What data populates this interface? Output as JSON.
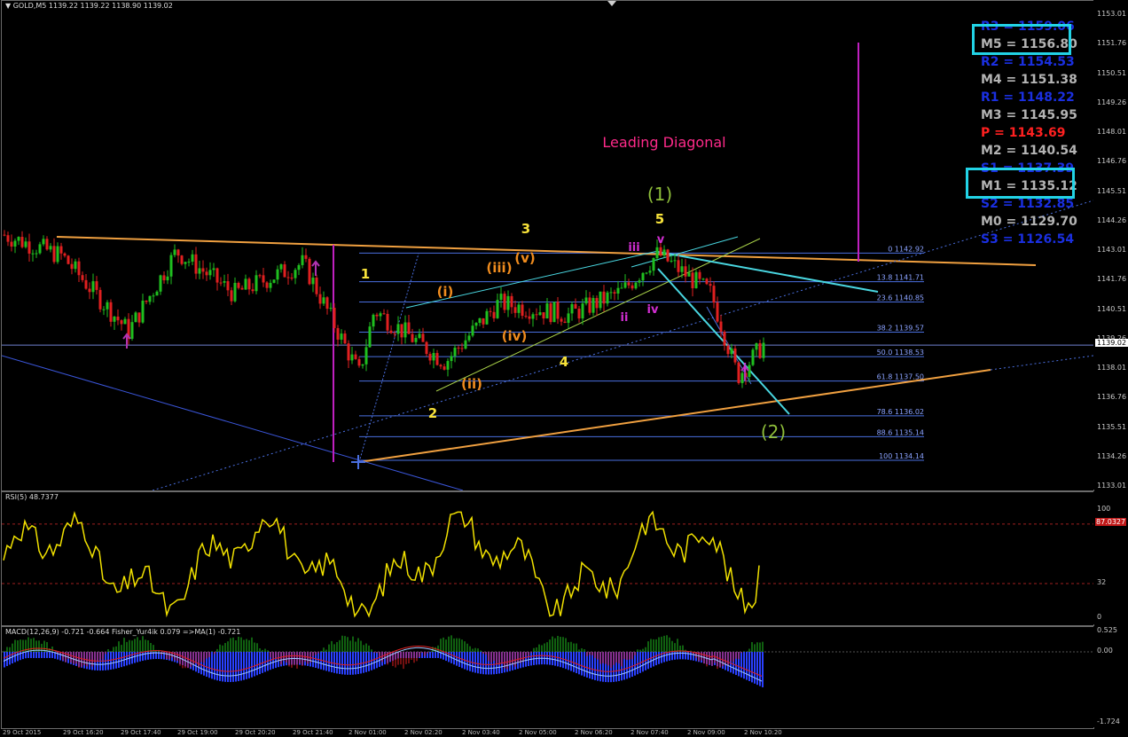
{
  "header": {
    "symbol_label": "GOLD,M5  1139.22 1139.22 1138.90 1139.02"
  },
  "annotation": {
    "title": "Leading Diagonal",
    "wave1": "(1)",
    "wave2": "(2)"
  },
  "wave_labels": [
    {
      "t": "1",
      "c": "#f7e23a"
    },
    {
      "t": "2",
      "c": "#f7e23a"
    },
    {
      "t": "3",
      "c": "#f7e23a"
    },
    {
      "t": "4",
      "c": "#f7e23a"
    },
    {
      "t": "5",
      "c": "#f7e23a"
    },
    {
      "t": "(i)",
      "c": "#f08c1e"
    },
    {
      "t": "(ii)",
      "c": "#f08c1e"
    },
    {
      "t": "(iii)",
      "c": "#f08c1e"
    },
    {
      "t": "(iv)",
      "c": "#f08c1e"
    },
    {
      "t": "(v)",
      "c": "#f08c1e"
    },
    {
      "t": "i",
      "c": "#d22ed2"
    },
    {
      "t": "ii",
      "c": "#d22ed2"
    },
    {
      "t": "iii",
      "c": "#d22ed2"
    },
    {
      "t": "iv",
      "c": "#d22ed2"
    },
    {
      "t": "v",
      "c": "#d22ed2"
    }
  ],
  "fib_levels": [
    {
      "label": "0 1142.92",
      "price": 1142.92
    },
    {
      "label": "13.8 1141.71",
      "price": 1141.71
    },
    {
      "label": "23.6 1140.85",
      "price": 1140.85
    },
    {
      "label": "38.2 1139.57",
      "price": 1139.57
    },
    {
      "label": "50.0 1138.53",
      "price": 1138.53
    },
    {
      "label": "61.8 1137.50",
      "price": 1137.5
    },
    {
      "label": "78.6 1136.02",
      "price": 1136.02
    },
    {
      "label": "88.6 1135.14",
      "price": 1135.14
    },
    {
      "label": "100 1134.14",
      "price": 1134.14
    }
  ],
  "pivots": [
    {
      "label": "R3",
      "value": "1159.06",
      "color": "#1a2fe0",
      "boxed": false
    },
    {
      "label": "M5",
      "value": "1156.80",
      "color": "#b4b4b4",
      "boxed": true
    },
    {
      "label": "R2",
      "value": "1154.53",
      "color": "#1a2fe0",
      "boxed": false
    },
    {
      "label": "M4",
      "value": "1151.38",
      "color": "#b4b4b4",
      "boxed": false
    },
    {
      "label": "R1",
      "value": "1148.22",
      "color": "#1a2fe0",
      "boxed": false
    },
    {
      "label": "M3",
      "value": "1145.95",
      "color": "#b4b4b4",
      "boxed": false
    },
    {
      "label": "P",
      "value": "1143.69",
      "color": "#ff2020",
      "boxed": false
    },
    {
      "label": "M2",
      "value": "1140.54",
      "color": "#b4b4b4",
      "boxed": false
    },
    {
      "label": "S1",
      "value": "1137.39",
      "color": "#1a2fe0",
      "boxed": false
    },
    {
      "label": "M1",
      "value": "1135.12",
      "color": "#b4b4b4",
      "boxed": true
    },
    {
      "label": "S2",
      "value": "1132.85",
      "color": "#1a2fe0",
      "boxed": false
    },
    {
      "label": "M0",
      "value": "1129.70",
      "color": "#b4b4b4",
      "boxed": false
    },
    {
      "label": "S3",
      "value": "1126.54",
      "color": "#1a2fe0",
      "boxed": false
    }
  ],
  "price_axis": {
    "ticks": [
      "1153.01",
      "1151.76",
      "1150.51",
      "1149.26",
      "1148.01",
      "1146.76",
      "1145.51",
      "1144.26",
      "1143.01",
      "1141.76",
      "1140.51",
      "1139.26",
      "1138.01",
      "1136.76",
      "1135.51",
      "1134.26",
      "1133.01"
    ],
    "current_price": "1139.02"
  },
  "rsi": {
    "label": "RSI(5) 48.7377",
    "ticks": [
      "100",
      "32",
      "0"
    ],
    "upper_value": "87.0327"
  },
  "macd": {
    "label": "MACD(12,26,9) -0.721 -0.664  Fisher_Yur4ik 0.079  =>MA(1) -0.721",
    "ticks": [
      "0.525",
      "0.00",
      "-1.724"
    ]
  },
  "time_axis": [
    "29 Oct 2015",
    "29 Oct 16:20",
    "29 Oct 17:40",
    "29 Oct 19:00",
    "29 Oct 20:20",
    "29 Oct 21:40",
    "2 Nov 01:00",
    "2 Nov 02:20",
    "2 Nov 03:40",
    "2 Nov 05:00",
    "2 Nov 06:20",
    "2 Nov 07:40",
    "2 Nov 09:00",
    "2 Nov 10:20"
  ],
  "chart_data": [
    {
      "type": "candlestick",
      "title": "GOLD,M5",
      "ohlc_last": {
        "open": 1139.22,
        "high": 1139.22,
        "low": 1138.9,
        "close": 1139.02
      },
      "ylim": [
        1133.01,
        1153.01
      ],
      "close_path": [
        {
          "t": "29 Oct 2015",
          "y": 1143.7
        },
        {
          "t": "29 Oct 16:20",
          "y": 1142.8
        },
        {
          "t": "29 Oct 17:40",
          "y": 1139.6
        },
        {
          "t": "29 Oct 19:00",
          "y": 1143.0
        },
        {
          "t": "29 Oct 20:20",
          "y": 1141.2
        },
        {
          "t": "29 Oct 21:40",
          "y": 1142.5
        },
        {
          "t": "2 Nov 01:00",
          "y": 1137.8
        },
        {
          "t": "2 Nov 01:00",
          "y": 1140.5
        },
        {
          "t": "2 Nov 02:20",
          "y": 1138.3
        },
        {
          "t": "2 Nov 03:40",
          "y": 1140.8
        },
        {
          "t": "2 Nov 05:00",
          "y": 1140.3
        },
        {
          "t": "2 Nov 06:20",
          "y": 1141.3
        },
        {
          "t": "2 Nov 07:40",
          "y": 1142.9
        },
        {
          "t": "2 Nov 09:00",
          "y": 1141.2
        },
        {
          "t": "2 Nov 09:00",
          "y": 1137.7
        },
        {
          "t": "2 Nov 10:20",
          "y": 1139.0
        }
      ]
    },
    {
      "type": "line",
      "title": "RSI(5)",
      "ylim": [
        0,
        100
      ],
      "levels": [
        87.0327,
        32
      ],
      "last": 48.7377
    },
    {
      "type": "bar",
      "title": "MACD(12,26,9)",
      "ylim": [
        -1.724,
        0.525
      ],
      "last": {
        "macd": -0.721,
        "signal": -0.664,
        "fisher": 0.079
      }
    }
  ],
  "colors": {
    "bull": "#1fbf1f",
    "bear": "#e02020",
    "rsi": "#f0e000",
    "macd_pos": "#2a40ff",
    "fisher_pos": "#1fbf1f",
    "fisher_neg": "#e02020",
    "fib": "#4a6fe0",
    "trend": "#f0a040",
    "cyan": "#49d6e0",
    "magenta": "#c020c0"
  }
}
